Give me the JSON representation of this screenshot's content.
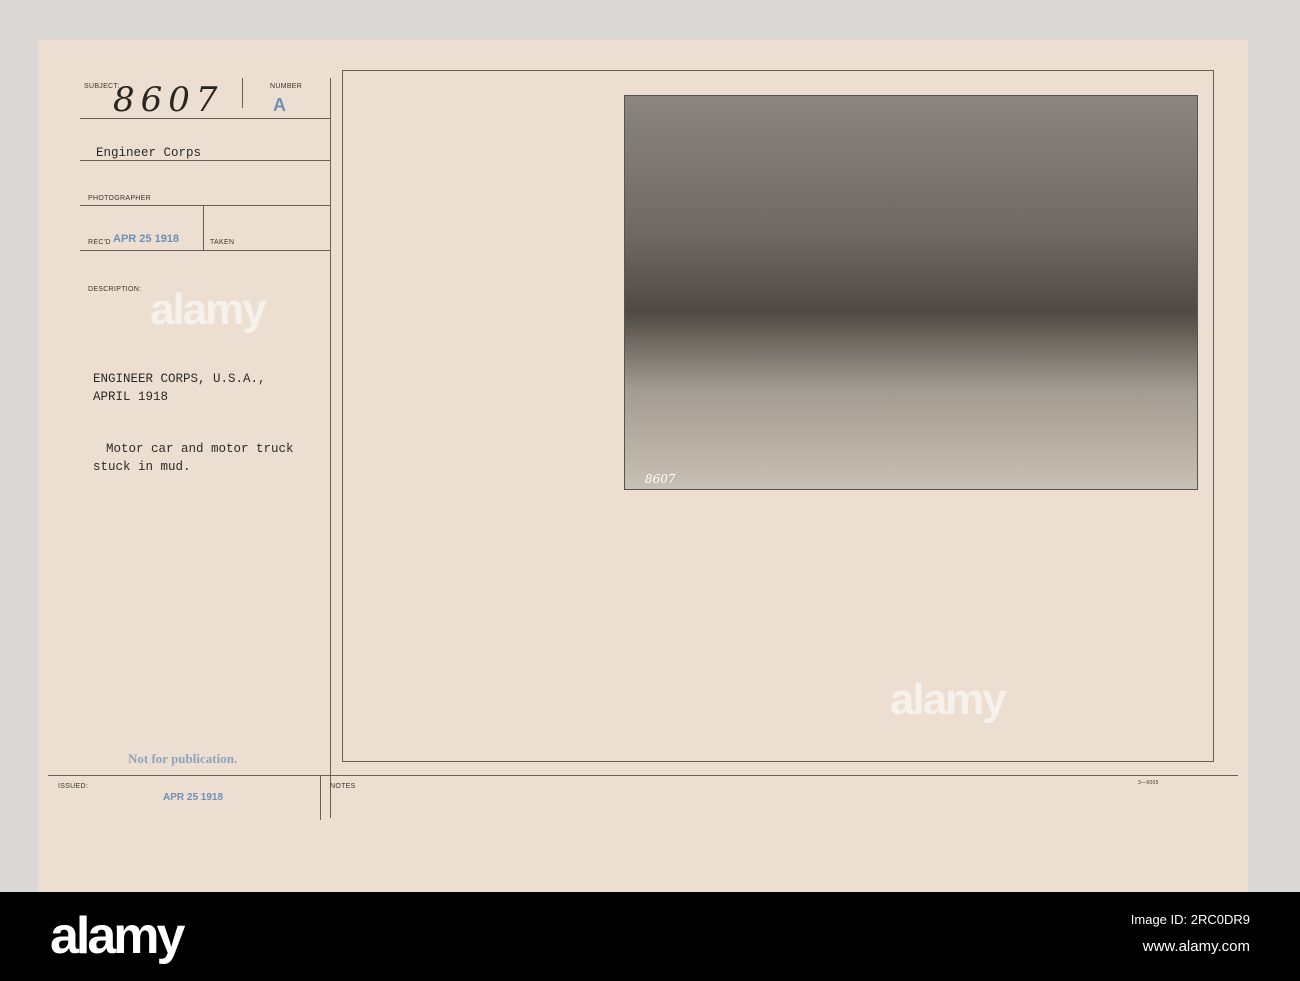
{
  "card": {
    "subject_label": "SUBJECT:",
    "subject_value": "8607",
    "number_label": "NUMBER",
    "number_value": "A",
    "subject_title": "Engineer Corps",
    "photographer_label": "PHOTOGRAPHER",
    "recd_label": "REC'D",
    "recd_stamp": "APR 25 1918",
    "taken_label": "TAKEN",
    "description_label": "DESCRIPTION:",
    "description_line1": "ENGINEER CORPS, U.S.A.,",
    "description_line2": "APRIL 1918",
    "caption_line1": "Motor car and motor truck",
    "caption_line2": "stuck in mud.",
    "publication_stamp": "Not for publication.",
    "issued_label": "ISSUED:",
    "issued_stamp": "APR 25 1918",
    "notes_label": "NOTES",
    "form_number": "3—9005",
    "photo_number": "8607"
  },
  "watermark": "alamy",
  "banner": {
    "logo": "alamy",
    "image_id": "Image ID: 2RC0DR9",
    "url": "www.alamy.com"
  }
}
